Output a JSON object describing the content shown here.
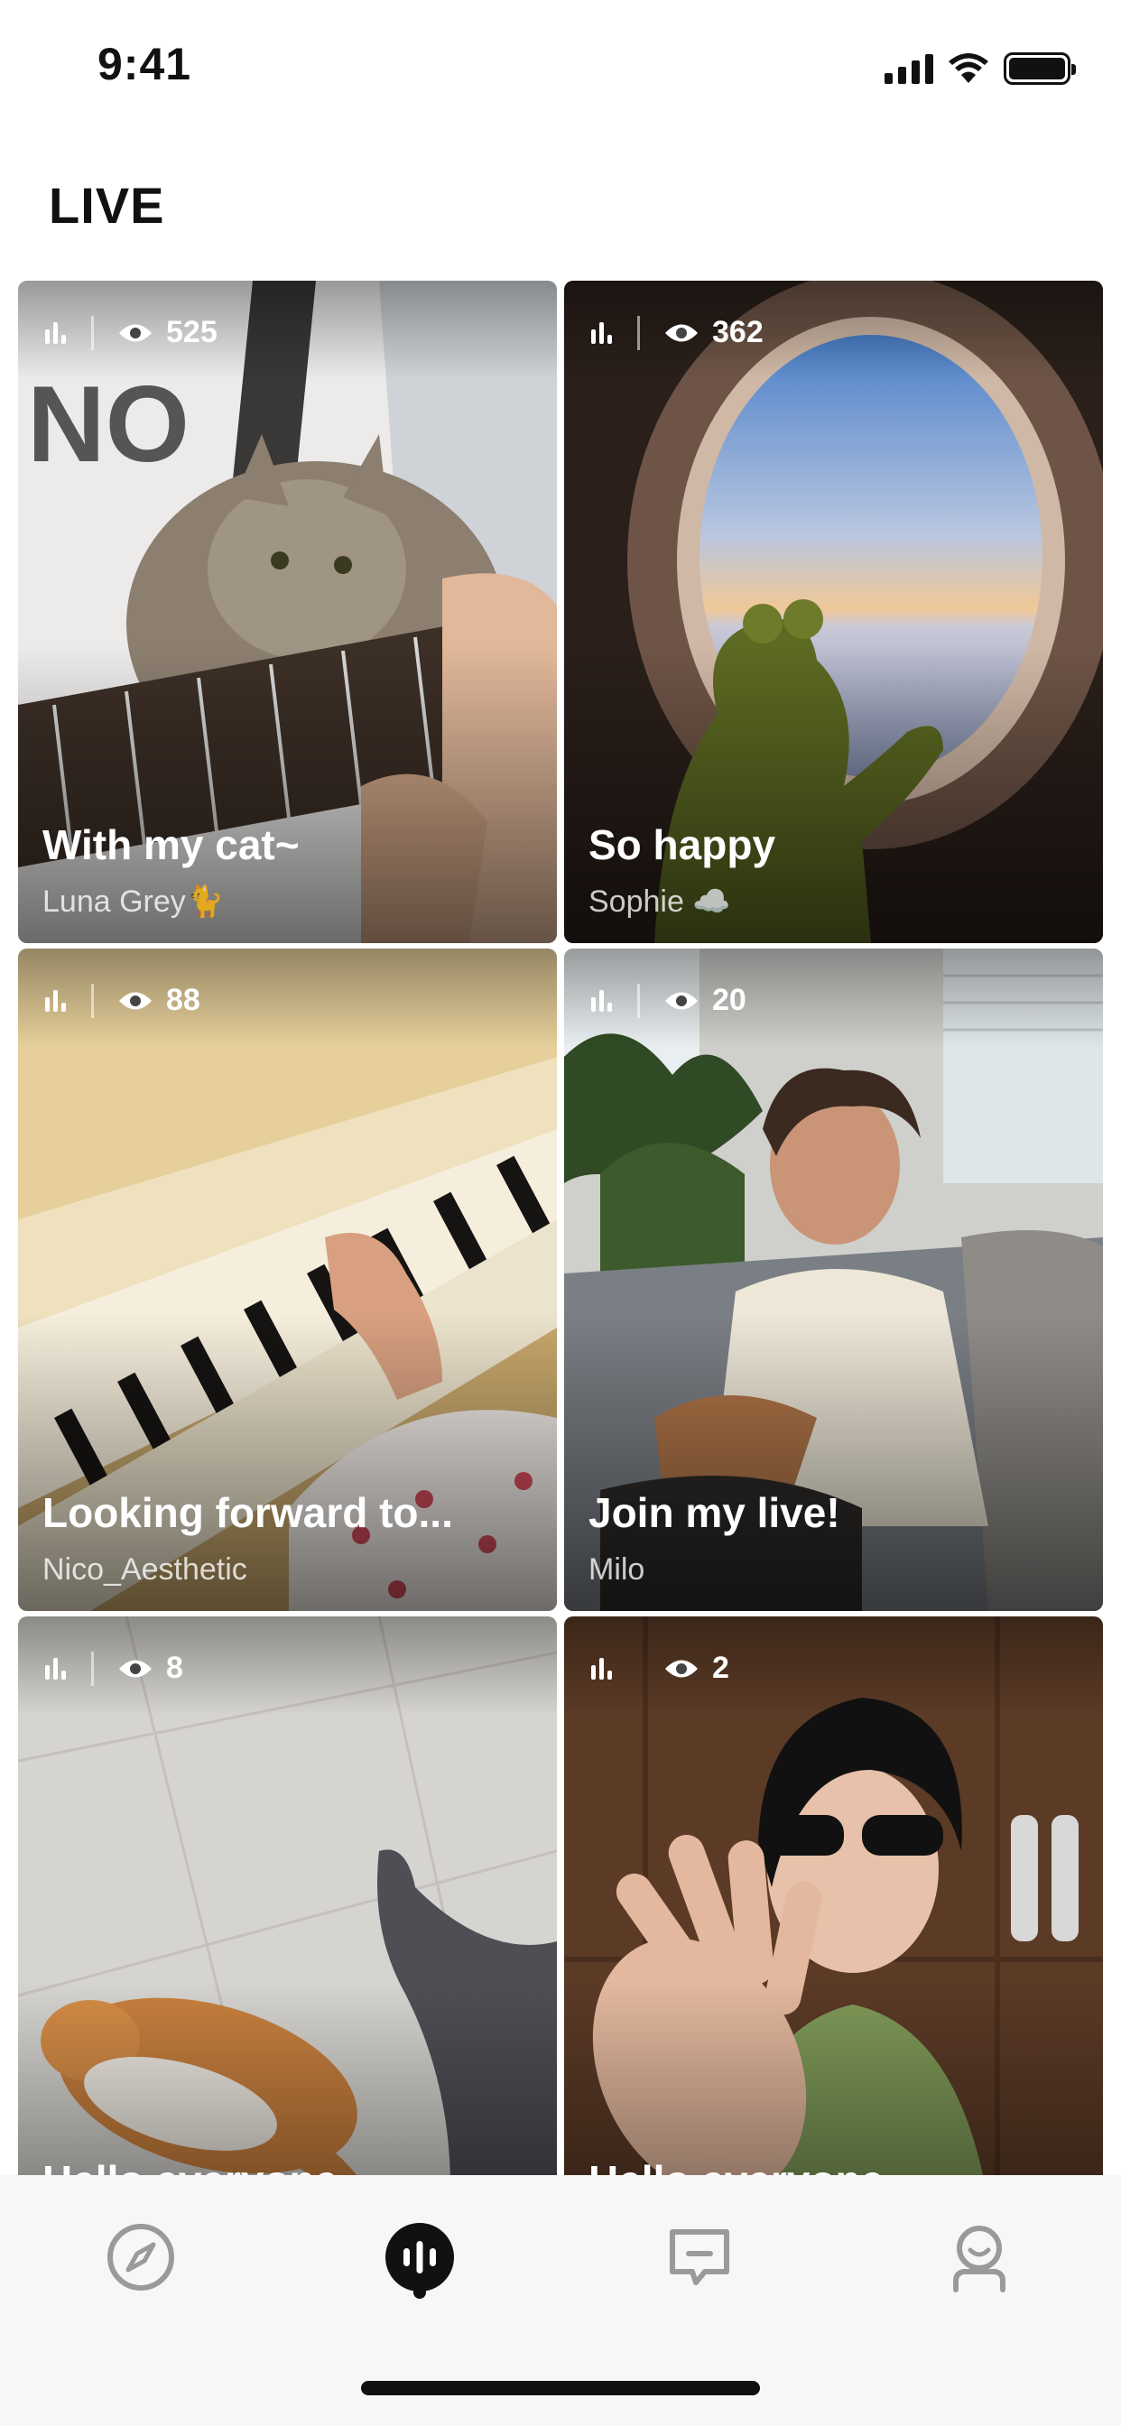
{
  "status_bar": {
    "time": "9:41"
  },
  "header": {
    "title": "LIVE"
  },
  "streams": [
    {
      "viewers": "525",
      "title": "With my cat~",
      "host": "Luna Grey🐈"
    },
    {
      "viewers": "362",
      "title": "So happy",
      "host": "Sophie ☁️"
    },
    {
      "viewers": "88",
      "title": "Looking forward to...",
      "host": "Nico_Aesthetic"
    },
    {
      "viewers": "20",
      "title": "Join my live!",
      "host": "Milo"
    },
    {
      "viewers": "8",
      "title": "Hello everyone",
      "host": ""
    },
    {
      "viewers": "2",
      "title": "Hello everyone",
      "host": ""
    }
  ],
  "tab_bar": {
    "items": [
      {
        "icon": "compass-icon"
      },
      {
        "icon": "live-icon"
      },
      {
        "icon": "messages-icon"
      },
      {
        "icon": "profile-icon"
      }
    ],
    "active_index": 1
  },
  "colors": {
    "accent": "#111111",
    "tab_inactive": "#9a9a9a"
  }
}
